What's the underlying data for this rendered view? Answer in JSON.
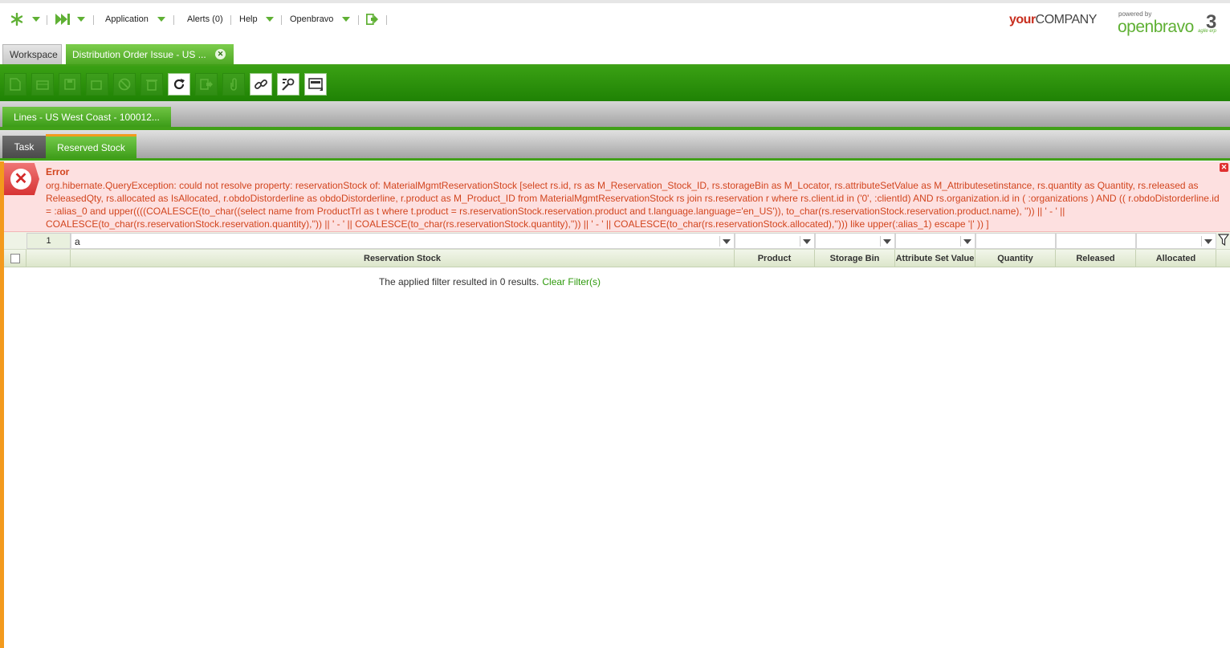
{
  "navbar": {
    "application_label": "Application",
    "alerts_label": "Alerts (0)",
    "help_label": "Help",
    "openbravo_label": "Openbravo",
    "logo_your": "your",
    "logo_company": "COMPANY",
    "powered_by": "powered by",
    "openbravo_logo": "openbravo",
    "agile_erp": "agile erp",
    "version_mark": "3"
  },
  "main_tabs": [
    {
      "label": "Workspace"
    },
    {
      "label": "Distribution Order Issue - US ..."
    }
  ],
  "toolbar": {
    "buttons": [
      "new-document",
      "new-row",
      "save",
      "undo",
      "delete",
      "trash",
      "refresh",
      "export",
      "attach",
      "link",
      "tools",
      "grid-view"
    ]
  },
  "subtab": {
    "label": "Lines - US West Coast - 100012..."
  },
  "child_tabs": [
    {
      "label": "Task"
    },
    {
      "label": "Reserved Stock"
    }
  ],
  "error": {
    "title": "Error",
    "message": "org.hibernate.QueryException: could not resolve property: reservationStock of: MaterialMgmtReservationStock [select rs.id, rs as M_Reservation_Stock_ID, rs.storageBin as M_Locator, rs.attributeSetValue as M_Attributesetinstance, rs.quantity as Quantity, rs.released as ReleasedQty, rs.allocated as IsAllocated, r.obdoDistorderline as obdoDistorderline, r.product as M_Product_ID from MaterialMgmtReservationStock rs join rs.reservation r where rs.client.id in ('0', :clientId) AND rs.organization.id in ( :organizations ) AND (( r.obdoDistorderline.id = :alias_0 and upper((((COALESCE(to_char((select name from ProductTrl as t where t.product = rs.reservationStock.reservation.product and t.language.language='en_US')), to_char(rs.reservationStock.reservation.product.name), '')) || ' - ' || COALESCE(to_char(rs.reservationStock.reservation.quantity),'')) || ' - ' || COALESCE(to_char(rs.reservationStock.quantity),'')) || ' - ' || COALESCE(to_char(rs.reservationStock.allocated),''))) like upper(:alias_1) escape '|' )) ]"
  },
  "grid": {
    "row_count": "1",
    "filter_value": "a",
    "columns": [
      "Reservation Stock",
      "Product",
      "Storage Bin",
      "Attribute Set Value",
      "Quantity",
      "Released",
      "Allocated"
    ],
    "empty_message": "The applied filter resulted in 0 results.",
    "clear_filter_label": "Clear Filter(s)"
  }
}
